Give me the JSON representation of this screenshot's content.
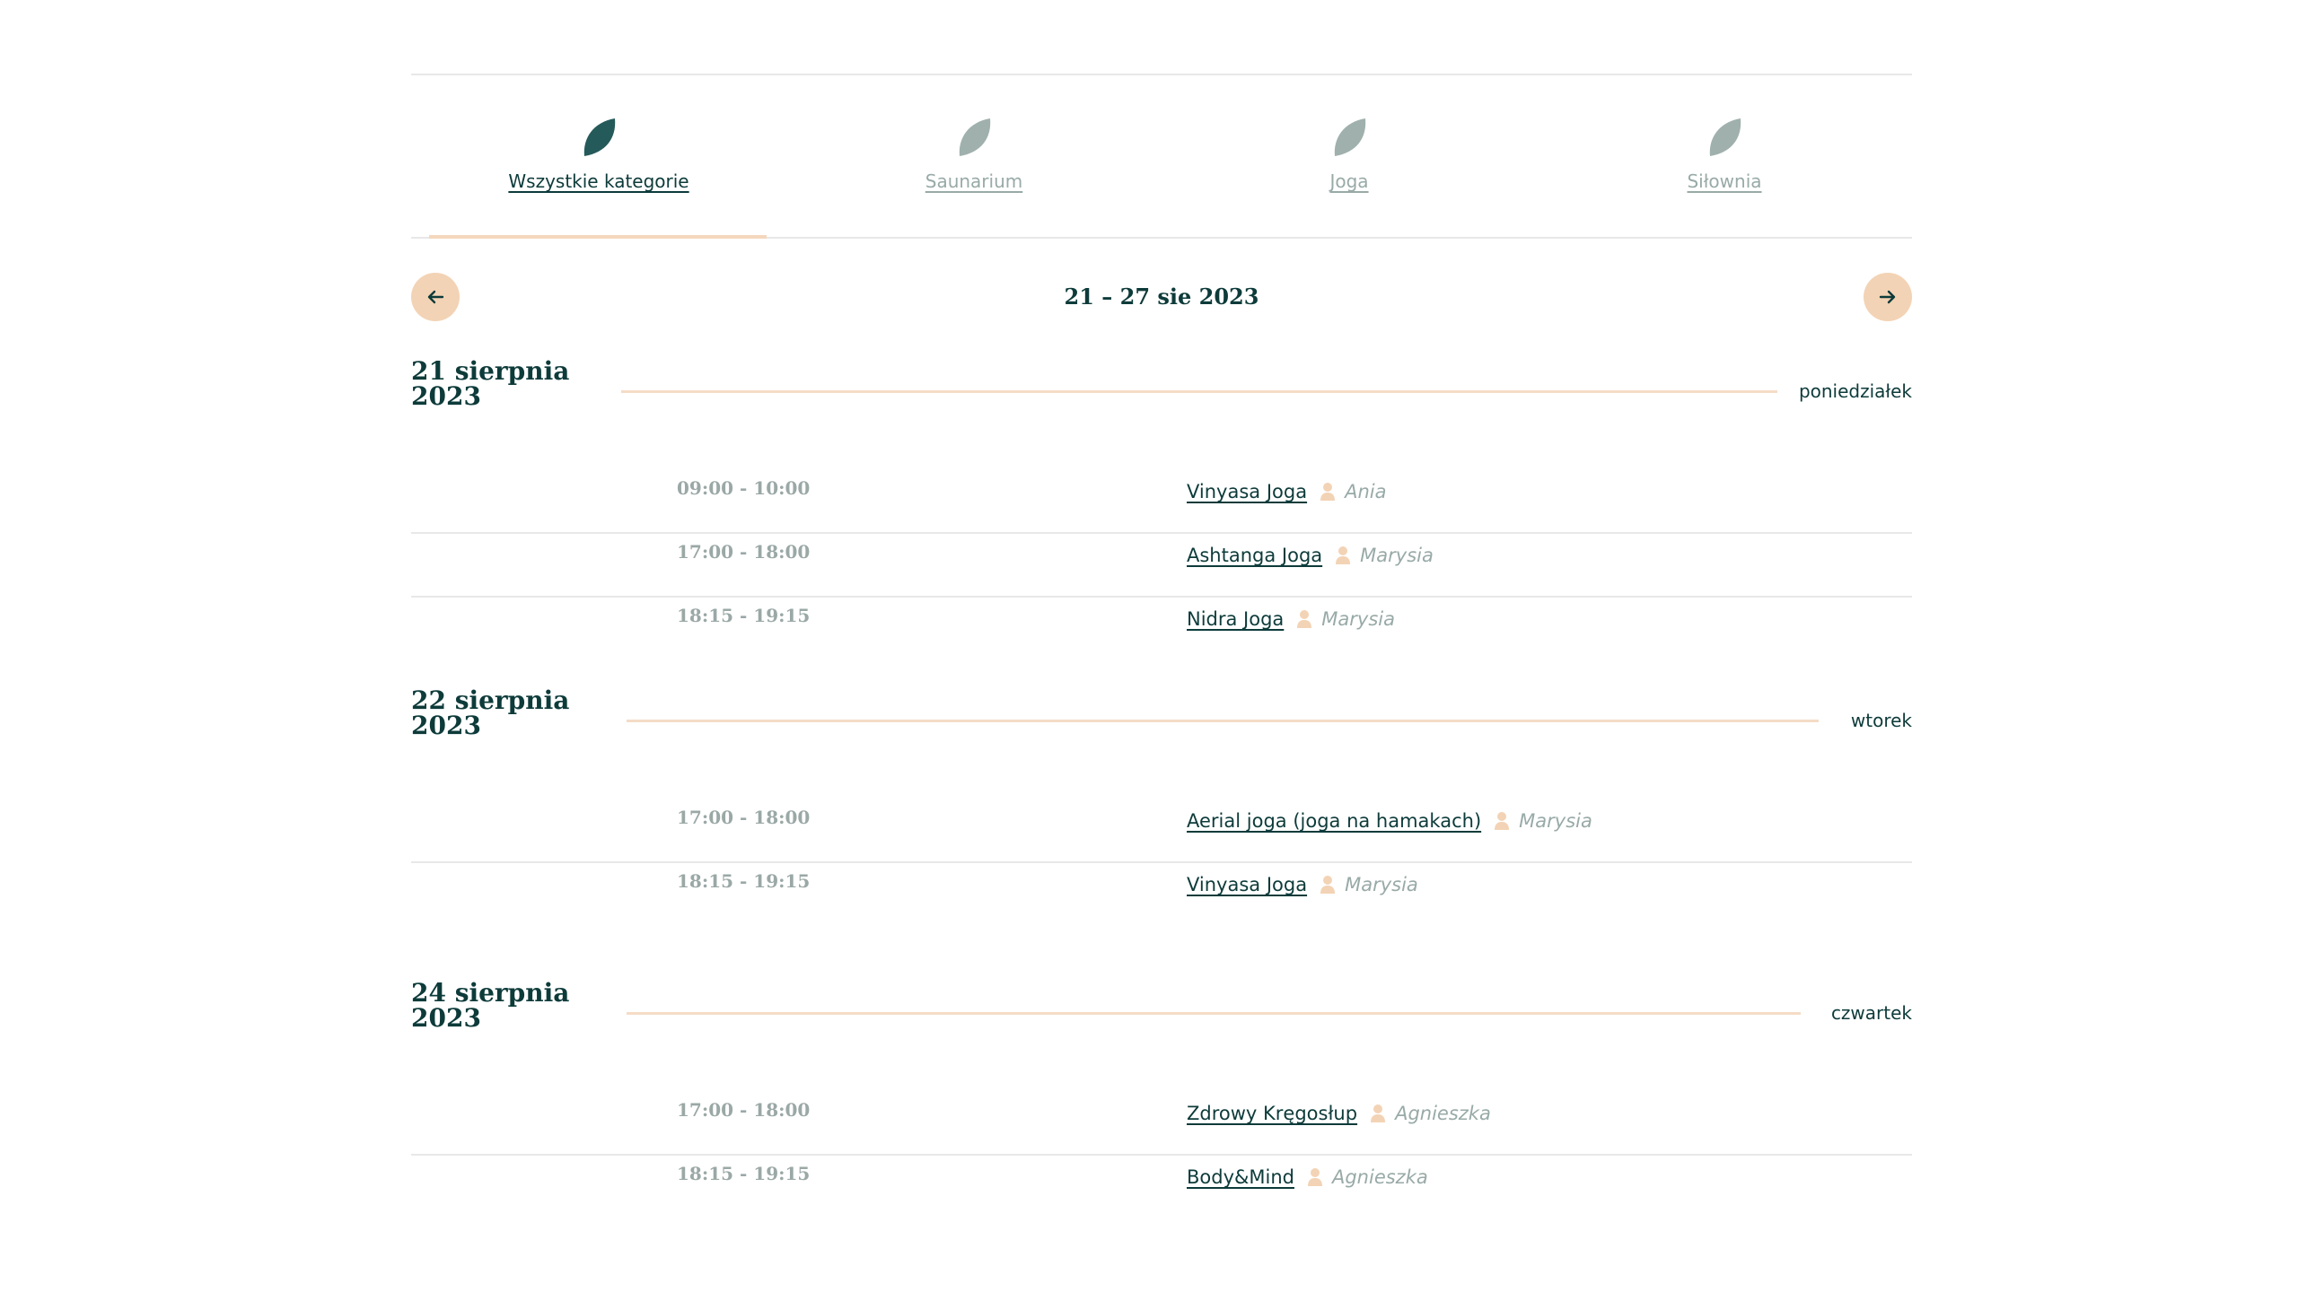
{
  "categories": [
    {
      "label": "Wszystkie kategorie",
      "active": true
    },
    {
      "label": "Saunarium",
      "active": false
    },
    {
      "label": "Joga",
      "active": false
    },
    {
      "label": "Siłownia",
      "active": false
    }
  ],
  "week": {
    "range": "21 – 27 sie 2023",
    "prev_icon": "arrow-left-icon",
    "next_icon": "arrow-right-icon"
  },
  "days": [
    {
      "date_line1": "21 sierpnia",
      "date_line2": "2023",
      "weekday": "poniedziałek",
      "sessions": [
        {
          "time": "09:00 - 10:00",
          "class": "Vinyasa Joga",
          "instructor": "Ania"
        },
        {
          "time": "17:00 - 18:00",
          "class": "Ashtanga Joga",
          "instructor": "Marysia"
        },
        {
          "time": "18:15 - 19:15",
          "class": "Nidra Joga",
          "instructor": "Marysia"
        }
      ]
    },
    {
      "date_line1": "22 sierpnia",
      "date_line2": "2023",
      "weekday": "wtorek",
      "sessions": [
        {
          "time": "17:00 - 18:00",
          "class": "Aerial joga (joga na hamakach)",
          "instructor": "Marysia"
        },
        {
          "time": "18:15 - 19:15",
          "class": "Vinyasa Joga",
          "instructor": "Marysia"
        }
      ]
    },
    {
      "date_line1": "24 sierpnia",
      "date_line2": "2023",
      "weekday": "czwartek",
      "sessions": [
        {
          "time": "17:00 - 18:00",
          "class": "Zdrowy Kręgosłup",
          "instructor": "Agnieszka"
        },
        {
          "time": "18:15 - 19:15",
          "class": "Body&Mind",
          "instructor": "Agnieszka"
        }
      ]
    }
  ],
  "colors": {
    "primary": "#0d3b3a",
    "muted": "#98aaa7",
    "accent": "#f3d3b5",
    "leaf_active": "#255a5a",
    "leaf_inactive": "#9fb0ad"
  }
}
